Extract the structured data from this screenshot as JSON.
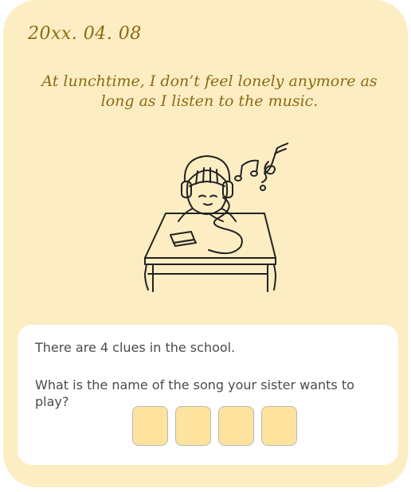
{
  "diary": {
    "date": "20xx. 04. 08",
    "entry": "At lunchtime, I don’t feel lonely anymore as long as I listen to the music."
  },
  "illustration": {
    "subject": "student-with-headphones-at-desk-icon"
  },
  "puzzle": {
    "clue_count_text": "There are 4 clues in the school.",
    "question": "What is the name of the song your sister wants to play?",
    "answer_slots": [
      "",
      "",
      "",
      ""
    ]
  },
  "colors": {
    "card_background": "#fdedc3",
    "text_accent": "#8b6a12",
    "answer_box_fill": "#fde39e"
  }
}
